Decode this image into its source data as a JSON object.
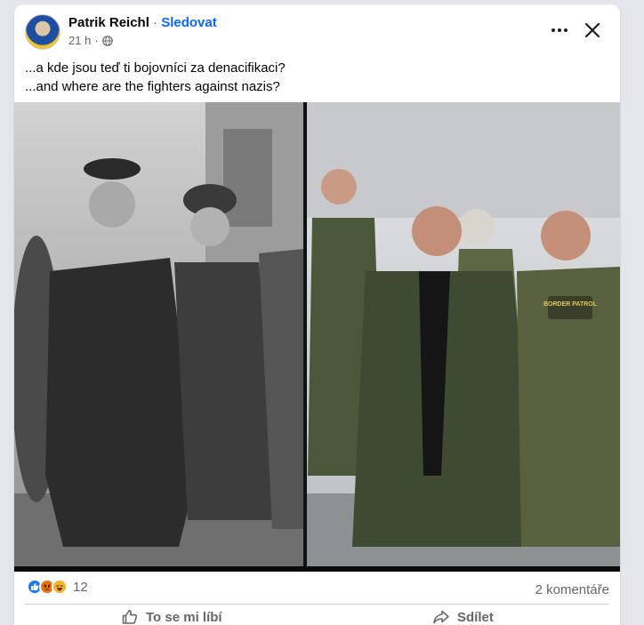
{
  "post": {
    "author": "Patrik Reichl",
    "separator": " · ",
    "follow_label": "Sledovat",
    "timestamp": "21 h",
    "meta_separator": "·",
    "text_line1": "...a kde jsou teď ti bojovníci za denacifikaci?",
    "text_line2": "...and where are the fighters against nazis?"
  },
  "reactions": {
    "icons": [
      "like-icon",
      "angry-icon",
      "haha-icon"
    ],
    "count": "12"
  },
  "comments_label": "2 komentáře",
  "actions": {
    "like_label": "To se mi líbí",
    "share_label": "Sdílet"
  },
  "image": {
    "patch_labels": [
      "BORDER PATROL"
    ]
  },
  "colors": {
    "accent": "#0866ff",
    "secondary_text": "#65676b",
    "like_blue": "#1877f2"
  }
}
